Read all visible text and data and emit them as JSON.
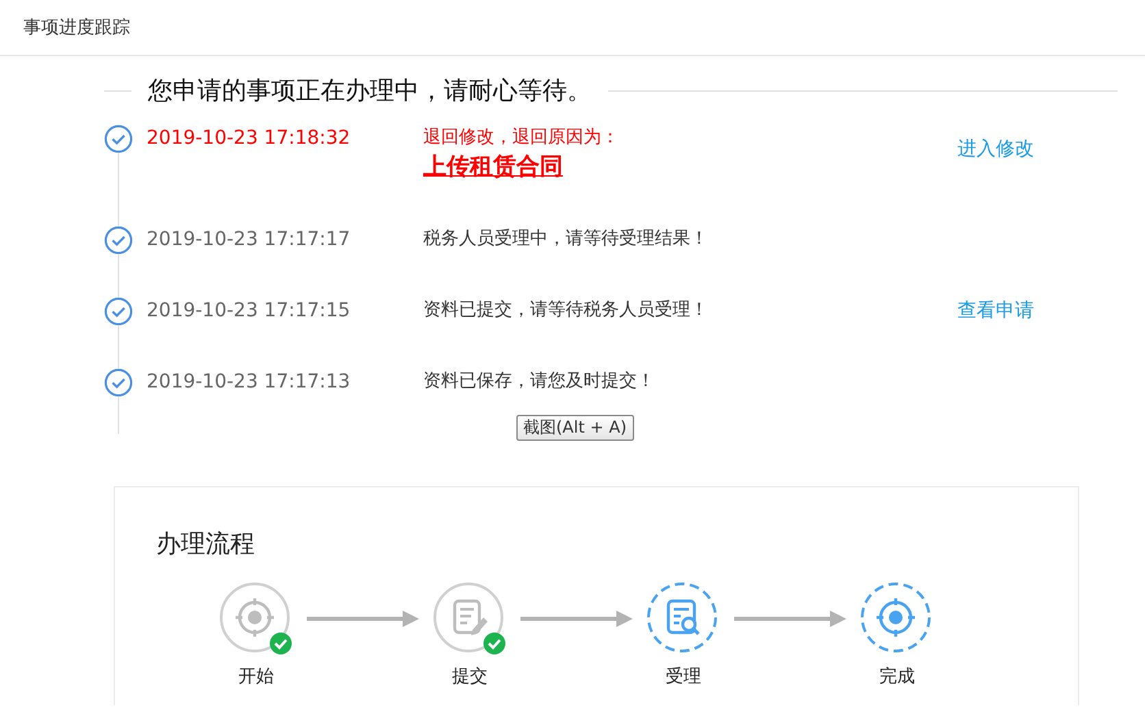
{
  "header": {
    "title": "事项进度跟踪"
  },
  "notice": "您申请的事项正在办理中，请耐心等待。",
  "timeline": [
    {
      "kind": "returned",
      "time": "2019-10-23 17:18:32",
      "message": "退回修改，退回原因为：",
      "reason": "上传租赁合同",
      "action": "进入修改"
    },
    {
      "kind": "normal",
      "time": "2019-10-23 17:17:17",
      "message": "税务人员受理中，请等待受理结果！"
    },
    {
      "kind": "normal",
      "time": "2019-10-23 17:17:15",
      "message": "资料已提交，请等待税务人员受理！",
      "action": "查看申请"
    },
    {
      "kind": "normal",
      "time": "2019-10-23 17:17:13",
      "message": "资料已保存，请您及时提交！"
    }
  ],
  "tooltip": "截图(Alt + A)",
  "flow": {
    "title": "办理流程",
    "steps": [
      {
        "label": "开始",
        "kind": "target",
        "done": true
      },
      {
        "label": "提交",
        "kind": "edit",
        "done": true
      },
      {
        "label": "受理",
        "kind": "search",
        "done": false
      },
      {
        "label": "完成",
        "kind": "target",
        "done": false
      }
    ]
  }
}
